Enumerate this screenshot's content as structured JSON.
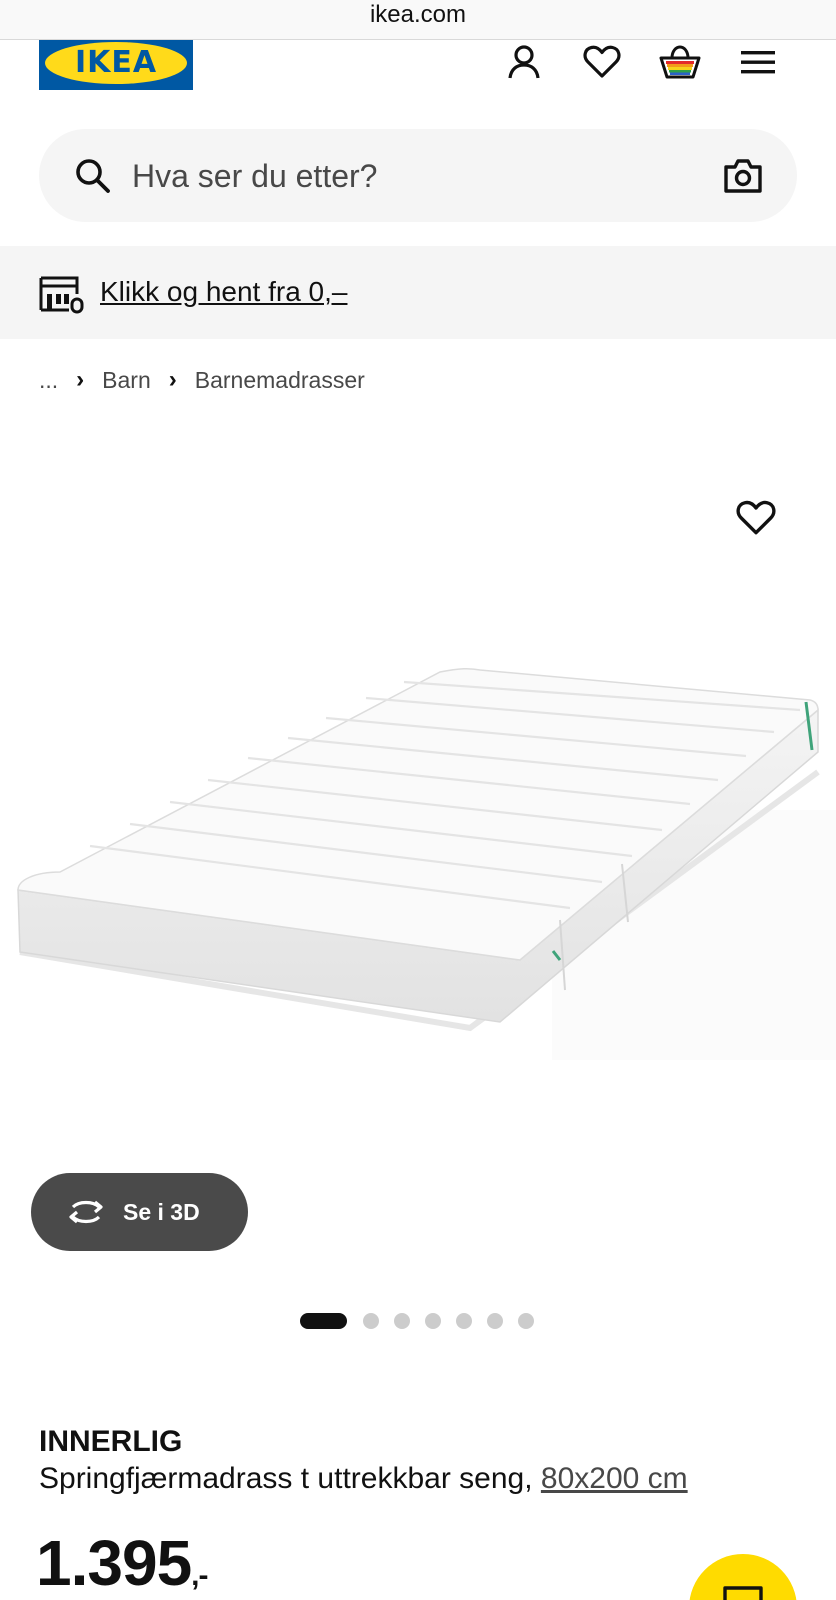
{
  "browser": {
    "url": "ikea.com"
  },
  "header": {
    "logo_text": "IKEA",
    "brand_colors": {
      "blue": "#0058a3",
      "yellow": "#ffda1a"
    },
    "icons": [
      "account-icon",
      "heart-icon",
      "cart-icon",
      "menu-icon"
    ]
  },
  "search": {
    "placeholder": "Hva ser du etter?",
    "icon": "search-icon",
    "camera_icon": "camera-icon"
  },
  "promo": {
    "icon": "store-icon",
    "link_text": "Klikk og hent fra 0,–"
  },
  "breadcrumb": {
    "ellipsis": "...",
    "items": [
      "Barn",
      "Barnemadrasser"
    ]
  },
  "gallery": {
    "favorite_icon": "heart-icon",
    "image": "mattress-product-image",
    "view_3d_label": "Se i 3D",
    "slide_count": 7,
    "active_slide": 1
  },
  "product": {
    "name": "INNERLIG",
    "description": "Springfjærmadrass t uttrekkbar seng,",
    "size_link": "80x200 cm",
    "price_main": "1.395",
    "price_suffix": ",-"
  },
  "chat": {
    "icon": "chat-icon",
    "color": "#ffdb00"
  }
}
